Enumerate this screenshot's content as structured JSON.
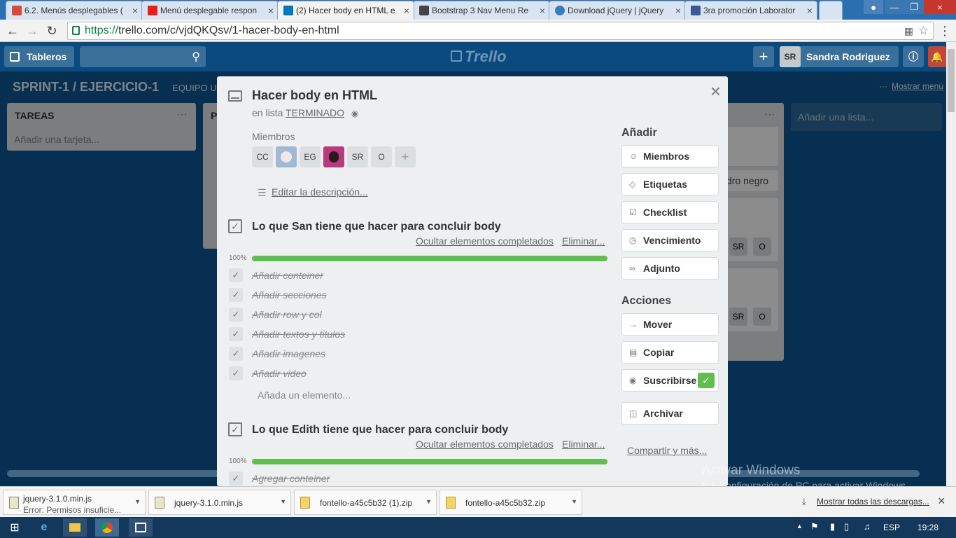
{
  "browser": {
    "tabs": [
      {
        "title": "6.2. Menús desplegables (",
        "color": "#d64a3a"
      },
      {
        "title": "Menú desplegable respon",
        "color": "#e62117"
      },
      {
        "title": "(2) Hacer body en HTML e",
        "color": "#0079bf",
        "active": true
      },
      {
        "title": "Bootstrap 3 Nav Menu Re",
        "color": "#444444"
      },
      {
        "title": "Download jQuery | jQuery",
        "color": "#3b7bbf"
      },
      {
        "title": "3ra promoción Laborator",
        "color": "#3b5998"
      }
    ],
    "url_scheme": "https://",
    "url_rest": "trello.com/c/vjdQKQsv/1-hacer-body-en-html"
  },
  "trello_header": {
    "boards_label": "Tableros",
    "logo": "Trello",
    "user_initials": "SR",
    "user_name": "Sandra Rodriguez"
  },
  "board": {
    "title": "SPRINT-1 / EJERCICIO-1",
    "team": "EQUIPO UN",
    "show_menu": "Mostrar menú",
    "lists": [
      {
        "title": "TAREAS",
        "add_card": "Añadir una tarjeta..."
      },
      {
        "title": "P"
      }
    ],
    "add_list": "Añadir una lista...",
    "bg_card_text": "dro negro",
    "bg_members": [
      "SR",
      "O"
    ]
  },
  "card": {
    "title": "Hacer body en HTML",
    "in_list_prefix": "en lista",
    "list_name": "TERMINADO",
    "members_label": "Miembros",
    "members": [
      "CC",
      "",
      "EG",
      "",
      "SR",
      "O"
    ],
    "add_member": "+",
    "edit_description": "Editar la descripción...",
    "checklists": [
      {
        "title": "Lo que San tiene que hacer para concluir body",
        "hide_completed": "Ocultar elementos completados",
        "delete": "Eliminar...",
        "progress": "100%",
        "progress_value": 1.0,
        "items": [
          "Añadir conteiner",
          "Añadir secciones",
          "Añadir row y col",
          "Añadir textos y titulos",
          "Añadir imagenes",
          "Añadir video"
        ],
        "add_item": "Añada un elemento..."
      },
      {
        "title": "Lo que Edith tiene que hacer para concluir body",
        "hide_completed": "Ocultar elementos completados",
        "delete": "Eliminar...",
        "progress": "100%",
        "progress_value": 1.0,
        "items": [
          "Agregar conteiner"
        ]
      }
    ],
    "sidebar": {
      "add_heading": "Añadir",
      "add_buttons": [
        "Miembros",
        "Etiquetas",
        "Checklist",
        "Vencimiento",
        "Adjunto"
      ],
      "actions_heading": "Acciones",
      "action_buttons": [
        "Mover",
        "Copiar",
        "Suscribirse",
        "Archivar"
      ],
      "share": "Compartir y más..."
    },
    "close": "×"
  },
  "watermark": {
    "line1": "Activar Windows",
    "line2": "Ir a Configuración de PC para activar Windows."
  },
  "downloads": {
    "items": [
      {
        "name": "jquery-3.1.0.min.js",
        "status": "Error: Permisos insuficie..."
      },
      {
        "name": "jquery-3.1.0.min.js",
        "status": ""
      },
      {
        "name": "fontello-a45c5b32 (1).zip",
        "status": ""
      },
      {
        "name": "fontello-a45c5b32.zip",
        "status": ""
      }
    ],
    "show_all": "Mostrar todas las descargas...",
    "close": "×"
  },
  "taskbar": {
    "lang": "ESP",
    "time": "19:28"
  },
  "colors": {
    "board_bg": "#0b5694",
    "progress_green": "#61bd4f",
    "subscribed_green": "#61bd4f"
  }
}
